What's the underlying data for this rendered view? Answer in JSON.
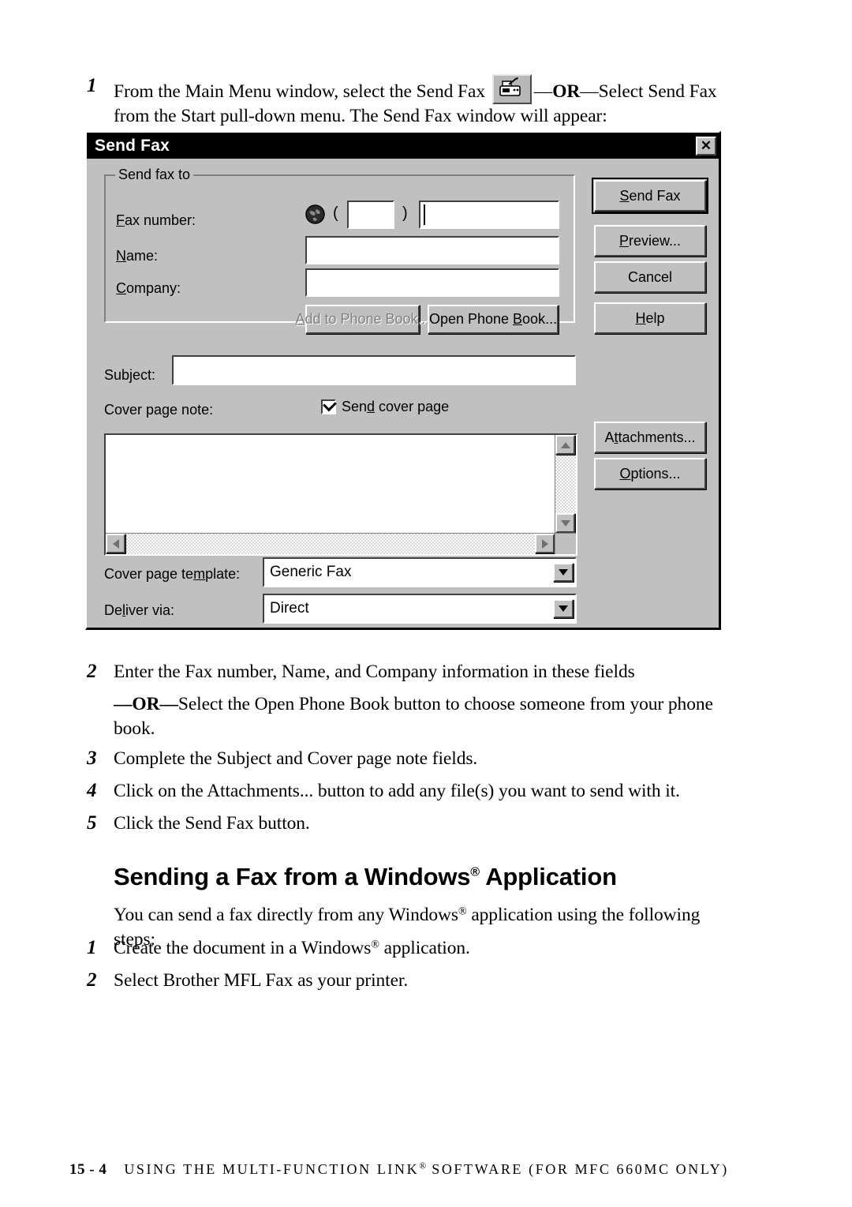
{
  "steps_top": [
    {
      "num": "1",
      "text_before": "From the Main Menu window, select the Send Fax",
      "icon": "fax-machine-icon",
      "text_dash1": "—",
      "text_or": "OR",
      "text_dash2": "—",
      "text_after": "Select Send Fax from the Start pull-down menu.  The Send Fax window will appear:"
    }
  ],
  "dialog": {
    "title": "Send Fax",
    "close_label": "✕",
    "close_icon": "close-icon",
    "group": {
      "legend": "Send fax to",
      "fax_number_label": {
        "pre": "",
        "mnemonic": "F",
        "post": "ax number:"
      },
      "globe_icon": "globe-icon",
      "paren_open": "(",
      "paren_close": ")",
      "area_code_value": "",
      "fax_number_value": "",
      "name_label": {
        "pre": "",
        "mnemonic": "N",
        "post": "ame:"
      },
      "name_value": "",
      "company_label": {
        "pre": "",
        "mnemonic": "C",
        "post": "ompany:"
      },
      "company_value": "",
      "add_phone_book_label": {
        "pre": "",
        "mnemonic": "A",
        "post": "dd to Phone Book..."
      },
      "add_phone_book_enabled": false,
      "open_phone_book_label": {
        "pre": "Open Phone ",
        "mnemonic": "B",
        "post": "ook..."
      }
    },
    "subject_label": {
      "pre": "Subject:",
      "mnemonic": "",
      "post": ""
    },
    "subject_value": "",
    "cover_note_label": "Cover page note:",
    "send_cover_page": {
      "pre": "Sen",
      "mnemonic": "d",
      "post": " cover page",
      "checked": true
    },
    "cover_note_value": "",
    "cover_template_label": {
      "pre": "Cover page te",
      "mnemonic": "m",
      "post": "plate:"
    },
    "cover_template_value": "Generic Fax",
    "deliver_via_label": {
      "pre": "De",
      "mnemonic": "l",
      "post": "iver via:"
    },
    "deliver_via_value": "Direct",
    "buttons_right": [
      {
        "name": "send-fax-button",
        "pre": "",
        "mnemonic": "S",
        "post": "end Fax",
        "default": true
      },
      {
        "name": "preview-button",
        "pre": "",
        "mnemonic": "P",
        "post": "review...",
        "default": false
      },
      {
        "name": "cancel-button",
        "pre": "Cancel",
        "mnemonic": "",
        "post": "",
        "default": false
      },
      {
        "name": "help-button",
        "pre": "",
        "mnemonic": "H",
        "post": "elp",
        "default": false
      }
    ],
    "buttons_right_lower": [
      {
        "name": "attachments-button",
        "pre": "A",
        "mnemonic": "t",
        "post": "tachments..."
      },
      {
        "name": "options-button",
        "pre": "",
        "mnemonic": "O",
        "post": "ptions..."
      }
    ]
  },
  "steps_mid": [
    {
      "num": "2",
      "text": "Enter the Fax number, Name, and Company information in these fields"
    },
    {
      "num": "3",
      "text": "Complete the Subject and Cover page note fields."
    },
    {
      "num": "4",
      "text": "Click on the Attachments... button to add any file(s) you want to send with it."
    },
    {
      "num": "5",
      "text": "Click the Send Fax button."
    }
  ],
  "or_paragraph": {
    "dash1": "—",
    "or": "OR",
    "dash2": "—",
    "text": "Select the Open Phone Book button to choose someone from your phone book."
  },
  "heading": {
    "pre": "Sending a Fax from a Windows",
    "reg": "®",
    "post": " Application"
  },
  "intro": {
    "pre": "You can send a fax directly from any Windows",
    "reg": "®",
    "post": " application using the following steps:"
  },
  "steps_bottom": [
    {
      "num": "1",
      "pre": "Create the document in a Windows",
      "reg": "®",
      "post": " application."
    },
    {
      "num": "2",
      "pre": "Select Brother MFL Fax as your printer.",
      "reg": "",
      "post": ""
    }
  ],
  "footer": {
    "page": "15 - 4",
    "pre": "USING THE MULTI-FUNCTION LINK",
    "reg": "®",
    "post": " SOFTWARE (FOR MFC 660MC ONLY)"
  }
}
